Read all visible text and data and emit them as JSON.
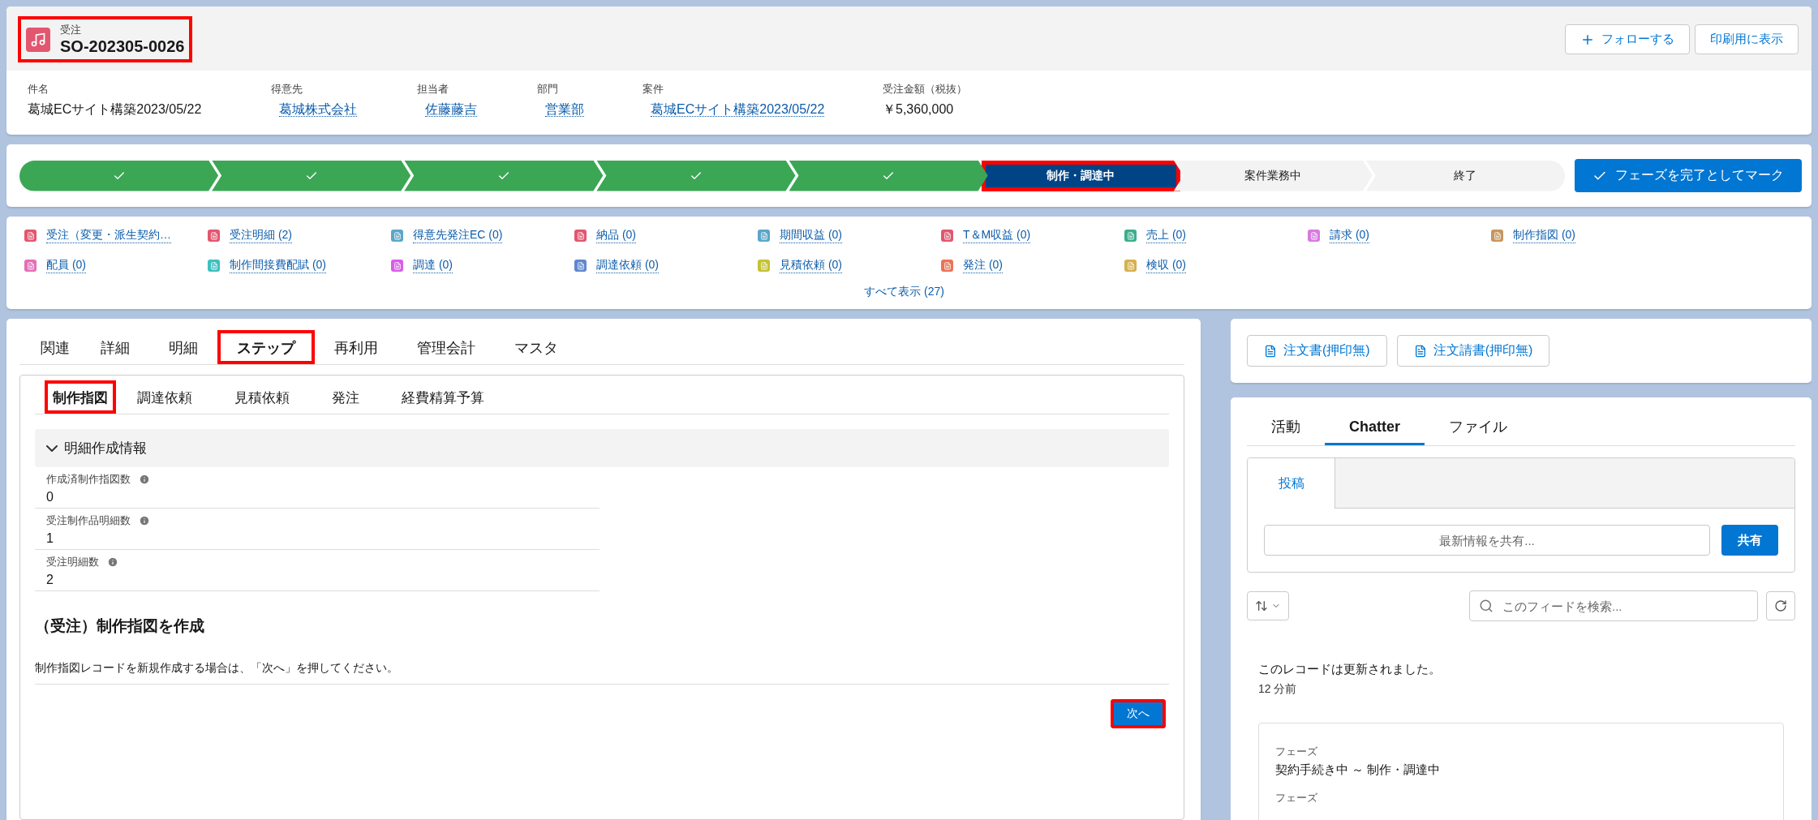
{
  "record": {
    "object_label": "受注",
    "name": "SO-202305-0026",
    "highlighted": true
  },
  "header_actions": [
    {
      "kind": "follow",
      "label": "フォローする"
    },
    {
      "kind": "plain",
      "label": "印刷用に表示"
    }
  ],
  "fields": [
    {
      "label": "件名",
      "value": "葛城ECサイト構築2023/05/22",
      "link": false
    },
    {
      "label": "得意先",
      "value": "葛城株式会社",
      "link": true
    },
    {
      "label": "担当者",
      "value": "佐藤藤吉",
      "link": true
    },
    {
      "label": "部門",
      "value": "営業部",
      "link": true
    },
    {
      "label": "案件",
      "value": "葛城ECサイト構築2023/05/22",
      "link": true
    },
    {
      "label": "受注金額（税抜）",
      "value": "￥5,360,000",
      "link": false
    }
  ],
  "path": {
    "steps": [
      {
        "completed": true,
        "current": false
      },
      {
        "completed": true,
        "current": false
      },
      {
        "completed": true,
        "current": false
      },
      {
        "completed": true,
        "current": false
      },
      {
        "completed": true,
        "current": false
      },
      {
        "completed": false,
        "current": true,
        "label": "制作・調達中",
        "highlighted": true
      },
      {
        "completed": false,
        "current": false,
        "label": "案件業務中",
        "highlighted": false
      },
      {
        "completed": false,
        "current": false,
        "label": "終了",
        "highlighted": false
      }
    ],
    "mark_button": "フェーズを完了としてマーク"
  },
  "related_links": [
    {
      "label": "受注（変更・派生契約…",
      "color": "#e3566f"
    },
    {
      "label": "受注明細 (2)",
      "color": "#e3566f"
    },
    {
      "label": "得意先発注EC (0)",
      "color": "#5ba6c9"
    },
    {
      "label": "納品 (0)",
      "color": "#e3566f"
    },
    {
      "label": "期間収益 (0)",
      "color": "#5ba6c9"
    },
    {
      "label": "T＆M収益 (0)",
      "color": "#e3566f"
    },
    {
      "label": "売上 (0)",
      "color": "#3bae8d"
    },
    {
      "label": "請求 (0)",
      "color": "#d77ae0"
    },
    {
      "label": "制作指図 (0)",
      "color": "#c8965c"
    },
    {
      "label": "配員 (0)",
      "color": "#e56eb8"
    },
    {
      "label": "制作間接費配賦 (0)",
      "color": "#3fc0c0"
    },
    {
      "label": "調達 (0)",
      "color": "#d85ee6"
    },
    {
      "label": "調達依頼 (0)",
      "color": "#5f88cf"
    },
    {
      "label": "見積依頼 (0)",
      "color": "#c4c235"
    },
    {
      "label": "発注 (0)",
      "color": "#ea7455"
    },
    {
      "label": "検収 (0)",
      "color": "#d7b04e"
    }
  ],
  "show_all": "すべて表示 (27)",
  "main_tabs": [
    {
      "label": "関連",
      "selected": false,
      "highlighted": false
    },
    {
      "label": "詳細",
      "selected": false,
      "highlighted": false
    },
    {
      "label": "明細",
      "selected": false,
      "highlighted": false
    },
    {
      "label": "ステップ",
      "selected": true,
      "highlighted": true
    },
    {
      "label": "再利用",
      "selected": false,
      "highlighted": false
    },
    {
      "label": "管理会計",
      "selected": false,
      "highlighted": false
    },
    {
      "label": "マスタ",
      "selected": false,
      "highlighted": false
    }
  ],
  "sub_tabs": [
    {
      "label": "制作指図",
      "selected": true,
      "highlighted": true
    },
    {
      "label": "調達依頼",
      "selected": false,
      "highlighted": false
    },
    {
      "label": "見積依頼",
      "selected": false,
      "highlighted": false
    },
    {
      "label": "発注",
      "selected": false,
      "highlighted": false
    },
    {
      "label": "経費精算予算",
      "selected": false,
      "highlighted": false
    }
  ],
  "section": {
    "title": "明細作成情報",
    "expanded": true,
    "fields": [
      {
        "label": "作成済制作指図数",
        "value": "0"
      },
      {
        "label": "受注制作品明細数",
        "value": "1"
      },
      {
        "label": "受注明細数",
        "value": "2"
      }
    ]
  },
  "flow": {
    "heading": "（受注）制作指図を作成",
    "description": "制作指図レコードを新規作成する場合は、「次へ」を押してください。",
    "next_button": {
      "label": "次へ",
      "highlighted": true
    }
  },
  "quick_actions": [
    "注文書(押印無)",
    "注文請書(押印無)"
  ],
  "side_tabs": [
    {
      "label": "活動",
      "selected": false
    },
    {
      "label": "Chatter",
      "selected": true
    },
    {
      "label": "ファイル",
      "selected": false
    }
  ],
  "publisher": {
    "tab": "投稿",
    "placeholder": "最新情報を共有...",
    "share_button": "共有"
  },
  "feed_search": {
    "placeholder": "このフィードを検索..."
  },
  "feed": {
    "message": "このレコードは更新されました。",
    "time": "12 分前",
    "changes": [
      {
        "label": "フェーズ",
        "value": "契約手続き中 ～ 制作・調達中"
      },
      {
        "label": "フェーズ"
      }
    ]
  }
}
